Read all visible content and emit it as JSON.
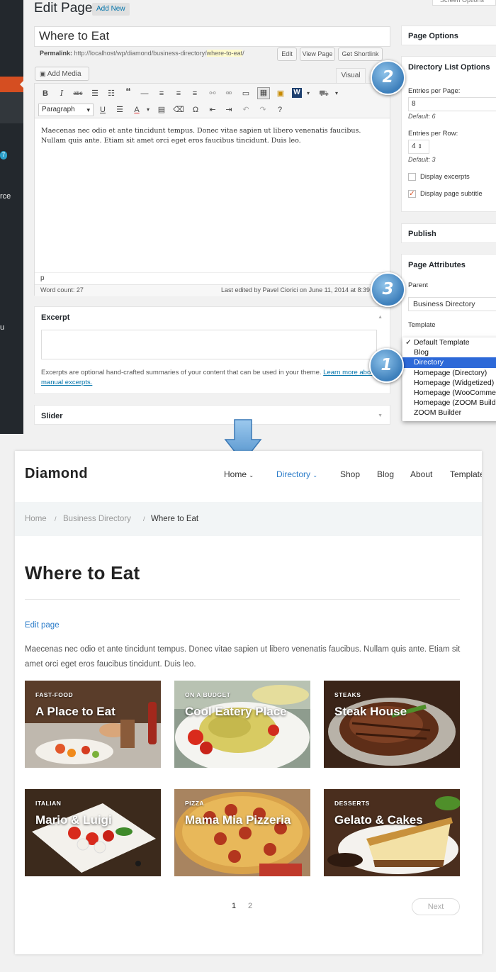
{
  "admin": {
    "edit_title": "Edit Page",
    "add_new": "Add New",
    "screen_options": "Screen Options",
    "post_title": "Where to Eat",
    "permalink_label": "Permalink:",
    "permalink_base": "http://localhost/wp/diamond/business-directory/",
    "permalink_slug": "where-to-eat",
    "permalink_end": "/",
    "btn_edit": "Edit",
    "btn_view_page": "View Page",
    "btn_shortlink": "Get Shortlink",
    "add_media": "Add Media",
    "tab_visual": "Visual",
    "format_select": "Paragraph",
    "editor_text": "Maecenas nec odio et ante tincidunt tempus. Donec vitae sapien ut libero venenatis faucibus. Nullam quis ante. Etiam sit amet orci eget eros faucibus tincidunt. Duis leo.",
    "path": "p",
    "word_count": "Word count: 27",
    "last_edited": "Last edited by Pavel Ciorici on June 11, 2014 at 8:39",
    "excerpt_title": "Excerpt",
    "excerpt_help": "Excerpts are optional hand-crafted summaries of your content that can be used in your theme.",
    "excerpt_link": "Learn more about manual excerpts.",
    "slider_title": "Slider",
    "page_options_title": "Page Options",
    "dlo_title": "Directory List Options",
    "entries_per_page_label": "Entries per Page:",
    "entries_per_page_value": "8",
    "entries_per_page_default": "Default: 6",
    "entries_per_row_label": "Entries per Row:",
    "entries_per_row_value": "4",
    "entries_per_row_default": "Default: 3",
    "display_excerpts": "Display excerpts",
    "display_subtitle": "Display page subtitle",
    "publish_title": "Publish",
    "page_attributes_title": "Page Attributes",
    "parent_label": "Parent",
    "parent_value": "Business Directory",
    "template_label": "Template",
    "template_options": [
      "Default Template",
      "Blog",
      "Directory",
      "Homepage (Directory)",
      "Homepage (Widgetized)",
      "Homepage (WooCommerce)",
      "Homepage (ZOOM Builder)",
      "ZOOM Builder"
    ],
    "template_checked": "Default Template",
    "template_highlighted": "Directory",
    "sidebar_bubble": "7",
    "sidebar_text_1": "rce",
    "sidebar_text_2": "u",
    "badges": [
      "1",
      "2",
      "3"
    ]
  },
  "site": {
    "logo": "Diamond",
    "nav": [
      {
        "label": "Home",
        "chevron": true,
        "active": false
      },
      {
        "label": "Directory",
        "chevron": true,
        "active": true
      },
      {
        "label": "Shop",
        "chevron": false,
        "active": false
      },
      {
        "label": "Blog",
        "chevron": false,
        "active": false
      },
      {
        "label": "About",
        "chevron": false,
        "active": false
      },
      {
        "label": "Templates",
        "chevron": false,
        "active": false
      }
    ],
    "breadcrumb": [
      "Home",
      "Business Directory",
      "Where to Eat"
    ],
    "page_title": "Where to Eat",
    "edit_link": "Edit page",
    "content": "Maecenas nec odio et ante tincidunt tempus. Donec vitae sapien ut libero venenatis faucibus. Nullam quis ante. Etiam sit amet orci eget eros faucibus tincidunt. Duis leo.",
    "listings": [
      {
        "category": "FAST-FOOD",
        "title": "A Place to Eat"
      },
      {
        "category": "ON A BUDGET",
        "title": "Cool Eatery Place"
      },
      {
        "category": "STEAKS",
        "title": "Steak House"
      },
      {
        "category": "ITALIAN",
        "title": "Mario & Luigi"
      },
      {
        "category": "PIZZA",
        "title": "Mama Mia Pizzeria"
      },
      {
        "category": "DESSERTS",
        "title": "Gelato & Cakes"
      }
    ],
    "pagination": [
      "1",
      "2"
    ],
    "next_label": "Next"
  },
  "colors": {
    "wp_blue": "#0073aa",
    "site_accent": "#2b7cc9",
    "select_highlight": "#2d69d8",
    "admin_menu": "#23282d"
  }
}
